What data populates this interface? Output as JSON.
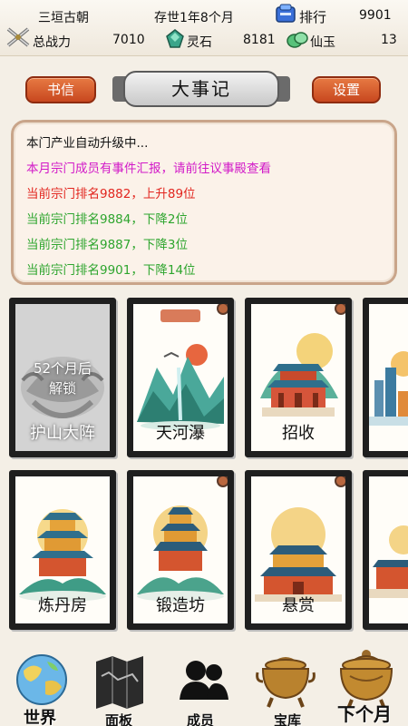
{
  "topbar": {
    "location": "三垣古朝",
    "era": "存世1年8个月",
    "rank_label": "排行",
    "rank_value": "9901",
    "power_label": "总战力",
    "power_value": "7010",
    "lingshi_label": "灵石",
    "lingshi_value": "8181",
    "xianyu_label": "仙玉",
    "xianyu_value": "13"
  },
  "header": {
    "mail_label": "书信",
    "title": "大事记",
    "settings_label": "设置"
  },
  "log": [
    {
      "text": "本门产业自动升级中...",
      "color": "#111111"
    },
    {
      "text": "本月宗门成员有事件汇报，请前往议事殿查看",
      "color": "#d21ac8"
    },
    {
      "text": "当前宗门排名9882，上升89位",
      "color": "#e2261f"
    },
    {
      "text": "当前宗门排名9884，下降2位",
      "color": "#2ea52e"
    },
    {
      "text": "当前宗门排名9887，下降3位",
      "color": "#2ea52e"
    },
    {
      "text": "当前宗门排名9901，下降14位",
      "color": "#2ea52e"
    }
  ],
  "buildings": [
    {
      "label": "护山大阵",
      "locked": true,
      "lock_text": "52个月后",
      "lock_sub": "解锁"
    },
    {
      "label": "天河瀑",
      "locked": false
    },
    {
      "label": "招收",
      "locked": false
    },
    {
      "label": "",
      "locked": false
    },
    {
      "label": "炼丹房",
      "locked": false
    },
    {
      "label": "锻造坊",
      "locked": false
    },
    {
      "label": "悬赏",
      "locked": false
    },
    {
      "label": "",
      "locked": false
    }
  ],
  "nav": {
    "world": "世界",
    "panel": "面板",
    "members": "成员",
    "treasury": "宝库",
    "next_month": "下个月"
  }
}
